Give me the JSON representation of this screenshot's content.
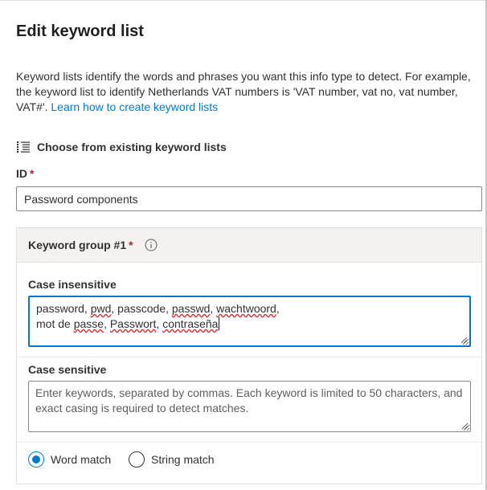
{
  "panel": {
    "title": "Edit keyword list",
    "description": "Keyword lists identify the words and phrases you want this info type to detect. For example, the keyword list to identify Netherlands VAT numbers is 'VAT number, vat no, vat number, VAT#'. ",
    "learn_link": "Learn how to create keyword lists",
    "choose_existing_label": "Choose from existing keyword lists",
    "choose_existing_icon": "bulleted-list-icon"
  },
  "id_field": {
    "label": "ID",
    "required_mark": "*",
    "value": "Password components"
  },
  "keyword_group": {
    "title": "Keyword group #1",
    "required_mark": "*",
    "info_icon": "info-icon",
    "case_insensitive": {
      "label": "Case insensitive",
      "line1": "password, pwd, passcode, passwd, wachtwoord,",
      "line2": "mot de passe, Passwort, contraseña"
    },
    "case_sensitive": {
      "label": "Case sensitive",
      "placeholder": "Enter keywords, separated by commas. Each keyword is limited to 50 characters, and exact casing is required to detect matches."
    },
    "match_options": [
      {
        "label": "Word match",
        "selected": true
      },
      {
        "label": "String match",
        "selected": false
      }
    ]
  },
  "colors": {
    "accent": "#0078d4",
    "required": "#a4262c",
    "spellcheck": "#d13438",
    "header_bg": "#f3f2f1"
  }
}
